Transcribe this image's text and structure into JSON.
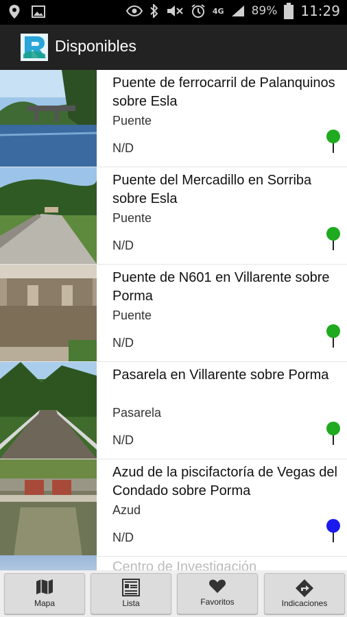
{
  "status_bar": {
    "network": "4G",
    "battery": "89%",
    "time": "11:29"
  },
  "app_bar": {
    "title": "Disponibles"
  },
  "items": [
    {
      "name": "Puente de ferrocarril de Palanquinos sobre Esla",
      "type": "Puente",
      "value": "N/D",
      "pin_color": "#1faa1f"
    },
    {
      "name": "Puente del Mercadillo en Sorriba sobre Esla",
      "type": "Puente",
      "value": "N/D",
      "pin_color": "#1faa1f"
    },
    {
      "name": "Puente de N601 en Villarente sobre Porma",
      "type": "Puente",
      "value": "N/D",
      "pin_color": "#1faa1f"
    },
    {
      "name": "Pasarela en Villarente sobre Porma",
      "type": "Pasarela",
      "value": "N/D",
      "pin_color": "#1faa1f"
    },
    {
      "name": "Azud de la piscifactoría de Vegas del Condado sobre Porma",
      "type": "Azud",
      "value": "N/D",
      "pin_color": "#1a1aee"
    }
  ],
  "partial_item": {
    "name": "Centro de Investigación"
  },
  "tabs": [
    {
      "label": "Mapa",
      "icon": "map-icon"
    },
    {
      "label": "Lista",
      "icon": "list-icon"
    },
    {
      "label": "Favoritos",
      "icon": "heart-icon"
    },
    {
      "label": "Indicaciones",
      "icon": "directions-icon"
    }
  ]
}
